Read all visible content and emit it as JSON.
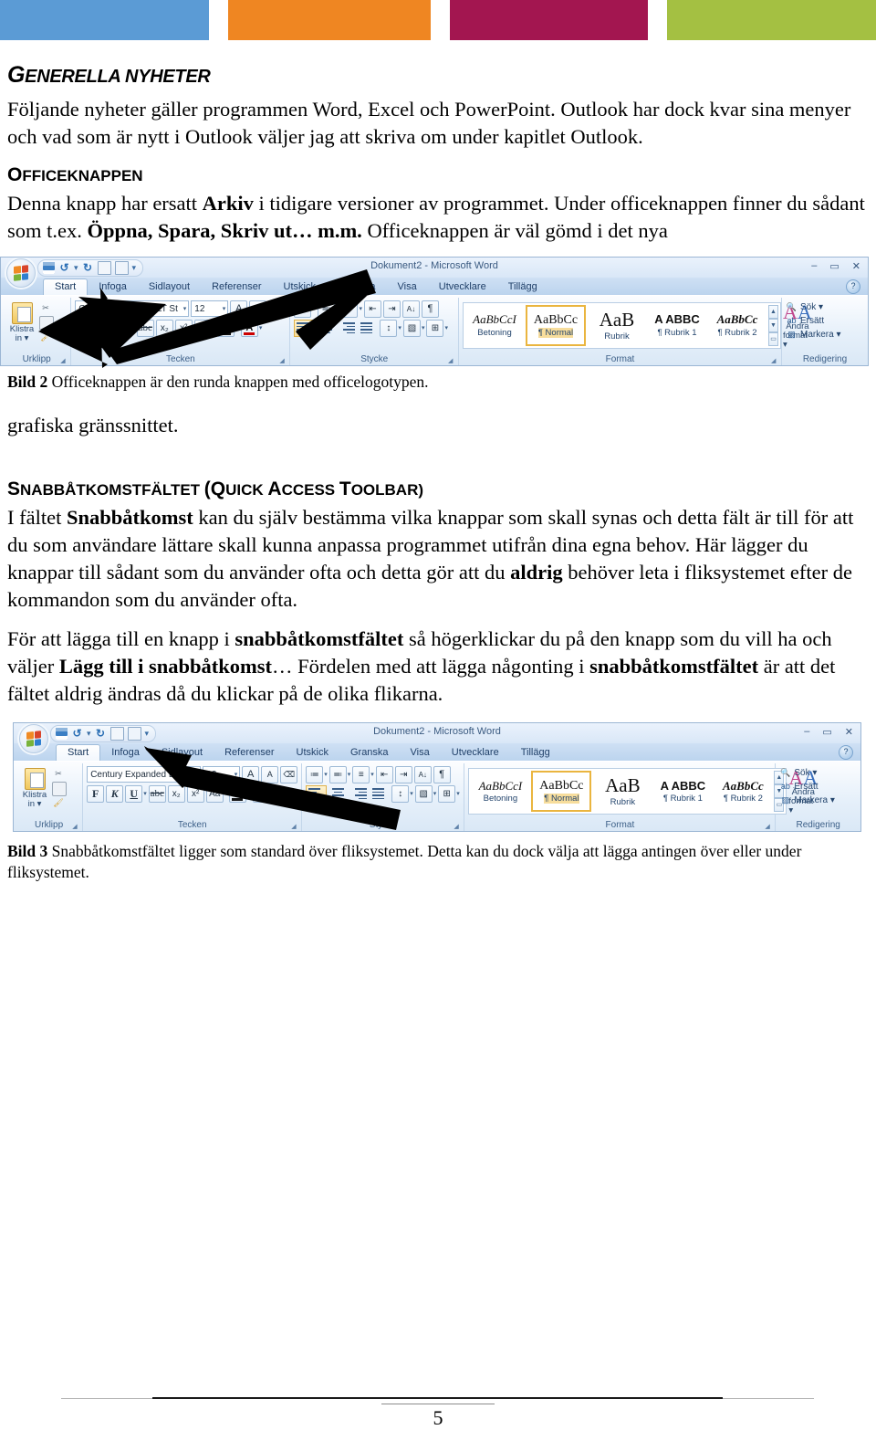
{
  "top_band": {
    "blocks": [
      {
        "name": "blue",
        "color": "#5b9bd5"
      },
      {
        "name": "orange",
        "color": "#ef8622"
      },
      {
        "name": "magenta",
        "color": "#a31650"
      },
      {
        "name": "green",
        "color": "#a4c042"
      }
    ]
  },
  "document": {
    "heading1": {
      "first": "G",
      "rest": "ENERELLA NYHETER"
    },
    "intro_paragraph": "Följande nyheter gäller programmen Word, Excel och PowerPoint. Outlook har dock kvar sina menyer och vad som är nytt i Outlook väljer jag att skriva om under kapitlet Outlook.",
    "heading2_office": {
      "first": "O",
      "rest": "FFICEKNAPPEN"
    },
    "office_paragraph": {
      "part1": "Denna knapp har ersatt ",
      "bold1": "Arkiv",
      "part2": " i tidigare versioner av programmet. Under officeknappen finner du sådant som t.ex. ",
      "bold2": "Öppna, Spara, Skriv ut… m.m.",
      "part3": " Officeknappen är väl gömd i det nya"
    },
    "caption_bild2": {
      "label": "Bild 2",
      "text": " Officeknappen är den runda knappen med officelogotypen."
    },
    "after_image_paragraph": "grafiska gränssnittet.",
    "heading2_qat": {
      "s1": "S",
      "s1rest": "NABBÅTKOMSTFÄLTET ",
      "s2": "(Q",
      "s2rest": "UICK ",
      "s3": "A",
      "s3rest": "CCESS ",
      "s4": "T",
      "s4rest": "OOLBAR)"
    },
    "qat_paragraph1": {
      "part1": "I fältet ",
      "bold1": "Snabbåtkomst",
      "part2": " kan du själv bestämma vilka knappar som skall synas och detta fält är till för att du som användare lättare skall kunna anpassa programmet utifrån dina egna behov. Här lägger du knappar till sådant som du använder ofta och detta gör att du ",
      "bold2": "aldrig",
      "part3": " behöver leta i fliksystemet efter de kommandon som du använder ofta."
    },
    "qat_paragraph2": {
      "part1": "För att lägga till en knapp i ",
      "bold1": "snabbåtkomstfältet",
      "part2": " så högerklickar du på den knapp som du vill ha och väljer ",
      "bold2": "Lägg till i snabbåtkomst",
      "part3": "… Fördelen med att lägga någonting i ",
      "bold3": "snabbåtkomstfältet",
      "part4": " är att det fältet aldrig ändras då du klickar på de olika flikarna."
    },
    "caption_bild3": {
      "label": "Bild 3",
      "text": " Snabbåtkomstfältet ligger som standard över fliksystemet. Detta kan du dock välja att lägga antingen över eller under fliksystemet."
    },
    "page_number": "5"
  },
  "word_ribbon": {
    "window_title": "Dokument2 - Microsoft Word",
    "window_buttons": [
      "–",
      "▭",
      "✕"
    ],
    "help_icon": "?",
    "quick_access": [
      {
        "name": "save-icon",
        "label": "Spara"
      },
      {
        "name": "undo-icon",
        "label": "Ångra"
      },
      {
        "name": "redo-icon",
        "label": "Gör om"
      },
      {
        "name": "print-preview-icon",
        "label": "Förhandsgranska"
      },
      {
        "name": "document-icon",
        "label": "Dokument"
      },
      {
        "name": "customize-qat-icon",
        "label": "Anpassa verktygsfältet"
      }
    ],
    "tabs": [
      {
        "label": "Start",
        "active": true
      },
      {
        "label": "Infoga",
        "active": false
      },
      {
        "label": "Sidlayout",
        "active": false
      },
      {
        "label": "Referenser",
        "active": false
      },
      {
        "label": "Utskick",
        "active": false
      },
      {
        "label": "Granska",
        "active": false
      },
      {
        "label": "Visa",
        "active": false
      },
      {
        "label": "Utvecklare",
        "active": false
      },
      {
        "label": "Tillägg",
        "active": false
      }
    ],
    "groups": {
      "clipboard": {
        "label": "Urklipp",
        "paste_label_1": "Klistra",
        "paste_label_2": "in ▾",
        "items": [
          "cut-icon",
          "copy-icon",
          "format-painter-icon"
        ]
      },
      "font": {
        "label": "Tecken",
        "font_name": "Century Expanded LT St",
        "font_size": "12",
        "grow_label": "A",
        "shrink_label": "A",
        "clear_format_label": "⌫",
        "bold_label": "F",
        "italic_label": "K",
        "underline_label": "U",
        "strike_label": "abc",
        "subscript_label": "x₂",
        "superscript_label": "x²",
        "case_label": "Aa",
        "highlight_label": "ab",
        "fontcolor_label": "A"
      },
      "paragraph": {
        "label": "Stycke",
        "bullets_label": "≔",
        "numbering_label": "≕",
        "multilevel_label": "≡",
        "dec_indent_label": "⇤",
        "inc_indent_label": "⇥",
        "sort_label": "A↓",
        "showmarks_label": "¶",
        "line_spacing_label": "↕",
        "shading_label": "▧",
        "borders_label": "⊞"
      },
      "styles": {
        "label": "Format",
        "items": [
          {
            "preview": "AaBbCcI",
            "name": "Betoning",
            "selected": false,
            "kind": "emph"
          },
          {
            "preview": "AaBbCc",
            "name": "¶ Normal",
            "selected": true,
            "kind": "normal"
          },
          {
            "preview": "AaB",
            "name": "Rubrik",
            "selected": false,
            "kind": "rubrik"
          },
          {
            "preview": "A ABBC",
            "name": "¶ Rubrik 1",
            "selected": false,
            "kind": "r1"
          },
          {
            "preview": "AaBbCc",
            "name": "¶ Rubrik 2",
            "selected": false,
            "kind": "r2"
          }
        ],
        "change_styles_label_1": "Ändra",
        "change_styles_label_2": "format ▾"
      },
      "editing": {
        "label": "Redigering",
        "items": [
          {
            "icon": "find-icon",
            "label": "Sök ▾"
          },
          {
            "icon": "replace-icon",
            "label": "Ersätt"
          },
          {
            "icon": "select-icon",
            "label": "Markera ▾"
          }
        ]
      }
    }
  }
}
